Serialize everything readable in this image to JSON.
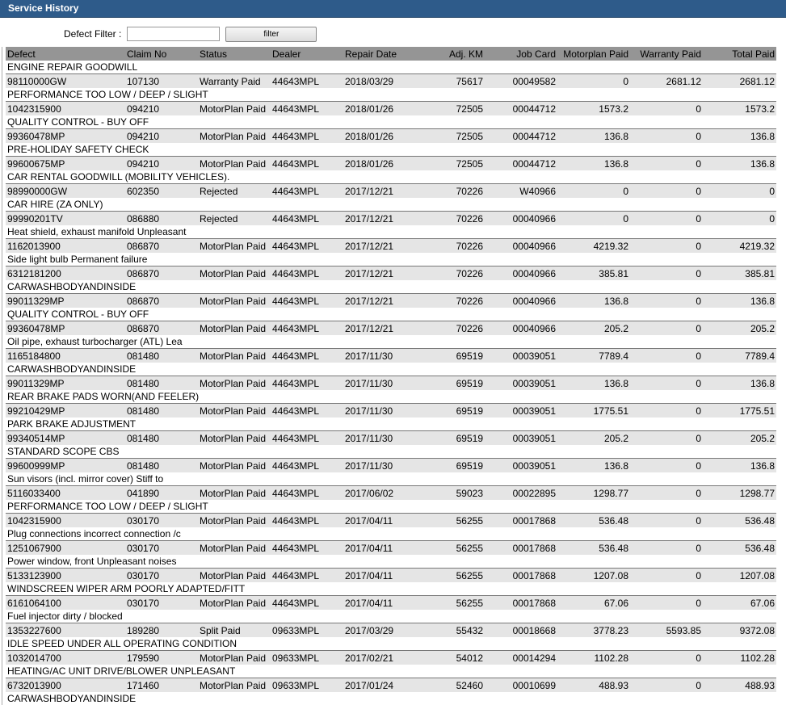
{
  "panel": {
    "title": "Service History"
  },
  "filter": {
    "label": "Defect Filter :",
    "value": "",
    "button_label": "filter"
  },
  "table": {
    "columns": [
      "Defect",
      "Claim No",
      "Status",
      "Dealer",
      "Repair Date",
      "Adj. KM",
      "Job Card",
      "Motorplan Paid",
      "Warranty Paid",
      "Total Paid"
    ],
    "records": [
      {
        "defect": "ENGINE REPAIR GOODWILL",
        "code": "98110000GW",
        "claim": "107130",
        "status": "Warranty Paid",
        "dealer": "44643MPL",
        "date": "2018/03/29",
        "km": "75617",
        "job": "00049582",
        "motorplan": "0",
        "warranty": "2681.12",
        "total": "2681.12"
      },
      {
        "defect": "PERFORMANCE TOO LOW / DEEP / SLIGHT",
        "code": "1042315900",
        "claim": "094210",
        "status": "MotorPlan Paid",
        "dealer": "44643MPL",
        "date": "2018/01/26",
        "km": "72505",
        "job": "00044712",
        "motorplan": "1573.2",
        "warranty": "0",
        "total": "1573.2"
      },
      {
        "defect": "QUALITY CONTROL - BUY OFF",
        "code": "99360478MP",
        "claim": "094210",
        "status": "MotorPlan Paid",
        "dealer": "44643MPL",
        "date": "2018/01/26",
        "km": "72505",
        "job": "00044712",
        "motorplan": "136.8",
        "warranty": "0",
        "total": "136.8"
      },
      {
        "defect": "PRE-HOLIDAY SAFETY CHECK",
        "code": "99600675MP",
        "claim": "094210",
        "status": "MotorPlan Paid",
        "dealer": "44643MPL",
        "date": "2018/01/26",
        "km": "72505",
        "job": "00044712",
        "motorplan": "136.8",
        "warranty": "0",
        "total": "136.8"
      },
      {
        "defect": "CAR RENTAL GOODWILL (MOBILITY VEHICLES).",
        "code": "98990000GW",
        "claim": "602350",
        "status": "Rejected",
        "dealer": "44643MPL",
        "date": "2017/12/21",
        "km": "70226",
        "job": "W40966",
        "motorplan": "0",
        "warranty": "0",
        "total": "0"
      },
      {
        "defect": "CAR HIRE (ZA ONLY)",
        "code": "99990201TV",
        "claim": "086880",
        "status": "Rejected",
        "dealer": "44643MPL",
        "date": "2017/12/21",
        "km": "70226",
        "job": "00040966",
        "motorplan": "0",
        "warranty": "0",
        "total": "0"
      },
      {
        "defect": "Heat shield, exhaust manifold Unpleasant",
        "code": "1162013900",
        "claim": "086870",
        "status": "MotorPlan Paid",
        "dealer": "44643MPL",
        "date": "2017/12/21",
        "km": "70226",
        "job": "00040966",
        "motorplan": "4219.32",
        "warranty": "0",
        "total": "4219.32"
      },
      {
        "defect": "Side light bulb Permanent failure",
        "code": "6312181200",
        "claim": "086870",
        "status": "MotorPlan Paid",
        "dealer": "44643MPL",
        "date": "2017/12/21",
        "km": "70226",
        "job": "00040966",
        "motorplan": "385.81",
        "warranty": "0",
        "total": "385.81"
      },
      {
        "defect": "CARWASHBODYANDINSIDE",
        "code": "99011329MP",
        "claim": "086870",
        "status": "MotorPlan Paid",
        "dealer": "44643MPL",
        "date": "2017/12/21",
        "km": "70226",
        "job": "00040966",
        "motorplan": "136.8",
        "warranty": "0",
        "total": "136.8"
      },
      {
        "defect": "QUALITY CONTROL - BUY OFF",
        "code": "99360478MP",
        "claim": "086870",
        "status": "MotorPlan Paid",
        "dealer": "44643MPL",
        "date": "2017/12/21",
        "km": "70226",
        "job": "00040966",
        "motorplan": "205.2",
        "warranty": "0",
        "total": "205.2"
      },
      {
        "defect": "Oil pipe, exhaust turbocharger (ATL) Lea",
        "code": "1165184800",
        "claim": "081480",
        "status": "MotorPlan Paid",
        "dealer": "44643MPL",
        "date": "2017/11/30",
        "km": "69519",
        "job": "00039051",
        "motorplan": "7789.4",
        "warranty": "0",
        "total": "7789.4"
      },
      {
        "defect": "CARWASHBODYANDINSIDE",
        "code": "99011329MP",
        "claim": "081480",
        "status": "MotorPlan Paid",
        "dealer": "44643MPL",
        "date": "2017/11/30",
        "km": "69519",
        "job": "00039051",
        "motorplan": "136.8",
        "warranty": "0",
        "total": "136.8"
      },
      {
        "defect": "REAR BRAKE PADS WORN(AND FEELER)",
        "code": "99210429MP",
        "claim": "081480",
        "status": "MotorPlan Paid",
        "dealer": "44643MPL",
        "date": "2017/11/30",
        "km": "69519",
        "job": "00039051",
        "motorplan": "1775.51",
        "warranty": "0",
        "total": "1775.51"
      },
      {
        "defect": "PARK BRAKE ADJUSTMENT",
        "code": "99340514MP",
        "claim": "081480",
        "status": "MotorPlan Paid",
        "dealer": "44643MPL",
        "date": "2017/11/30",
        "km": "69519",
        "job": "00039051",
        "motorplan": "205.2",
        "warranty": "0",
        "total": "205.2"
      },
      {
        "defect": "STANDARD SCOPE CBS",
        "code": "99600999MP",
        "claim": "081480",
        "status": "MotorPlan Paid",
        "dealer": "44643MPL",
        "date": "2017/11/30",
        "km": "69519",
        "job": "00039051",
        "motorplan": "136.8",
        "warranty": "0",
        "total": "136.8"
      },
      {
        "defect": "Sun visors (incl. mirror cover) Stiff to",
        "code": "5116033400",
        "claim": "041890",
        "status": "MotorPlan Paid",
        "dealer": "44643MPL",
        "date": "2017/06/02",
        "km": "59023",
        "job": "00022895",
        "motorplan": "1298.77",
        "warranty": "0",
        "total": "1298.77"
      },
      {
        "defect": "PERFORMANCE TOO LOW / DEEP / SLIGHT",
        "code": "1042315900",
        "claim": "030170",
        "status": "MotorPlan Paid",
        "dealer": "44643MPL",
        "date": "2017/04/11",
        "km": "56255",
        "job": "00017868",
        "motorplan": "536.48",
        "warranty": "0",
        "total": "536.48"
      },
      {
        "defect": "Plug connections incorrect connection /c",
        "code": "1251067900",
        "claim": "030170",
        "status": "MotorPlan Paid",
        "dealer": "44643MPL",
        "date": "2017/04/11",
        "km": "56255",
        "job": "00017868",
        "motorplan": "536.48",
        "warranty": "0",
        "total": "536.48"
      },
      {
        "defect": "Power window, front Unpleasant noises",
        "code": "5133123900",
        "claim": "030170",
        "status": "MotorPlan Paid",
        "dealer": "44643MPL",
        "date": "2017/04/11",
        "km": "56255",
        "job": "00017868",
        "motorplan": "1207.08",
        "warranty": "0",
        "total": "1207.08"
      },
      {
        "defect": "WINDSCREEN WIPER ARM POORLY ADAPTED/FITT",
        "code": "6161064100",
        "claim": "030170",
        "status": "MotorPlan Paid",
        "dealer": "44643MPL",
        "date": "2017/04/11",
        "km": "56255",
        "job": "00017868",
        "motorplan": "67.06",
        "warranty": "0",
        "total": "67.06"
      },
      {
        "defect": "Fuel injector dirty / blocked",
        "code": "1353227600",
        "claim": "189280",
        "status": "Split Paid",
        "dealer": "09633MPL",
        "date": "2017/03/29",
        "km": "55432",
        "job": "00018668",
        "motorplan": "3778.23",
        "warranty": "5593.85",
        "total": "9372.08"
      },
      {
        "defect": "IDLE SPEED UNDER ALL OPERATING CONDITION",
        "code": "1032014700",
        "claim": "179590",
        "status": "MotorPlan Paid",
        "dealer": "09633MPL",
        "date": "2017/02/21",
        "km": "54012",
        "job": "00014294",
        "motorplan": "1102.28",
        "warranty": "0",
        "total": "1102.28"
      },
      {
        "defect": "HEATING/AC UNIT DRIVE/BLOWER UNPLEASANT",
        "code": "6732013900",
        "claim": "171460",
        "status": "MotorPlan Paid",
        "dealer": "09633MPL",
        "date": "2017/01/24",
        "km": "52460",
        "job": "00010699",
        "motorplan": "488.93",
        "warranty": "0",
        "total": "488.93"
      },
      {
        "defect": "CARWASHBODYANDINSIDE",
        "code": "",
        "claim": "",
        "status": "",
        "dealer": "",
        "date": "",
        "km": "",
        "job": "",
        "motorplan": "",
        "warranty": "",
        "total": ""
      }
    ]
  }
}
